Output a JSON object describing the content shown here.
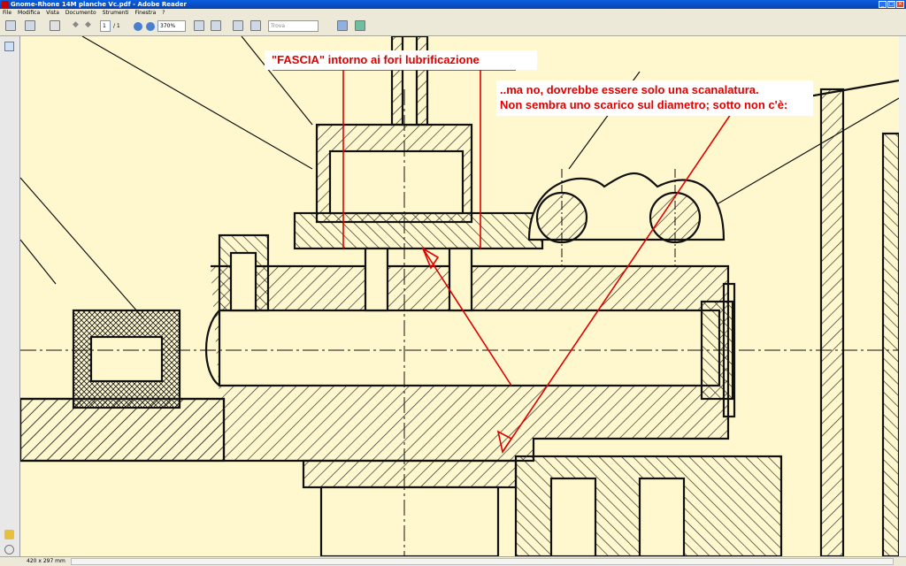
{
  "window": {
    "title": "Gnome-Rhone 14M planche Vc.pdf - Adobe Reader"
  },
  "menu": [
    "File",
    "Modifica",
    "Vista",
    "Documento",
    "Strumenti",
    "Finestra",
    "?"
  ],
  "toolbar": {
    "page_current": "1",
    "page_total": "/ 1",
    "zoom": "370%",
    "search_placeholder": "Trova"
  },
  "annotations": {
    "fascia_label": "\"FASCIA\" intorno ai fori lubrificazione",
    "note_line1": "..ma no, dovrebbe essere solo una scanalatura.",
    "note_line2": "Non sembra uno scarico sul diametro; sotto non c'è:"
  },
  "status": {
    "page_size": "420 x 297 mm"
  },
  "colors": {
    "paper": "#fff8cf",
    "annotation_red": "#e00000",
    "line": "#000000"
  }
}
